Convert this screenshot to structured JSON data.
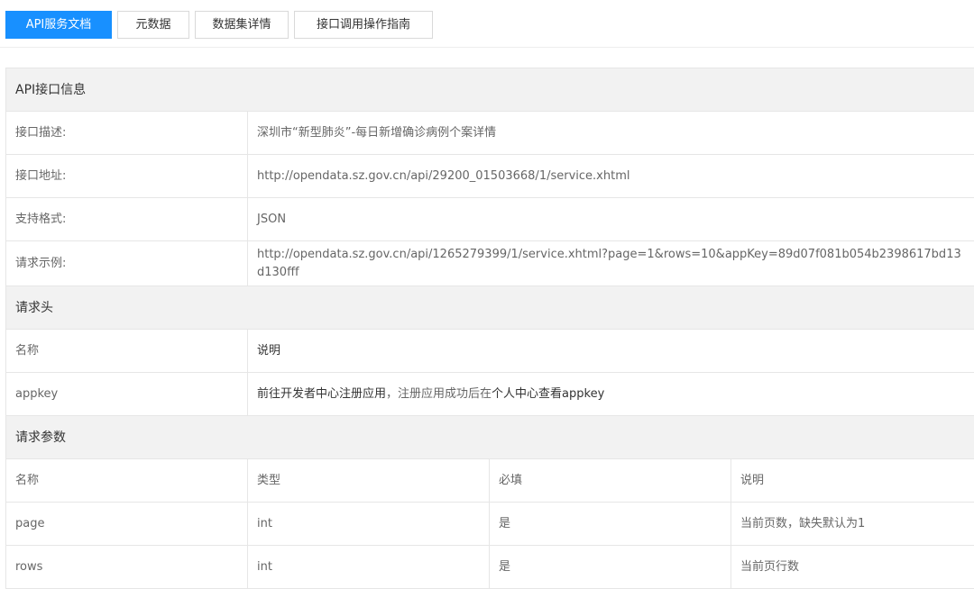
{
  "tabs": [
    {
      "label": "API服务文档",
      "active": true
    },
    {
      "label": "元数据",
      "active": false
    },
    {
      "label": "数据集详情",
      "active": false
    },
    {
      "label": "接口调用操作指南",
      "active": false
    }
  ],
  "api_info": {
    "section_title": "API接口信息",
    "rows": [
      {
        "label": "接口描述:",
        "value": "深圳市“新型肺炎”-每日新增确诊病例个案详情"
      },
      {
        "label": "接口地址:",
        "value": "http://opendata.sz.gov.cn/api/29200_01503668/1/service.xhtml"
      },
      {
        "label": "支持格式:",
        "value": "JSON"
      },
      {
        "label": "请求示例:",
        "value": "http://opendata.sz.gov.cn/api/1265279399/1/service.xhtml?page=1&rows=10&appKey=89d07f081b054b2398617bd13d130fff"
      }
    ]
  },
  "request_header": {
    "section_title": "请求头",
    "columns": [
      "名称",
      "说明"
    ],
    "rows": [
      {
        "name": "appkey",
        "desc_part1": "前往开发者中心注册应用",
        "desc_part2": "，注册应用成功后在",
        "desc_part3": "个人中心查看appkey"
      }
    ]
  },
  "request_params": {
    "section_title": "请求参数",
    "columns": [
      "名称",
      "类型",
      "必填",
      "说明"
    ],
    "rows": [
      {
        "name": "page",
        "type": "int",
        "required": "是",
        "desc": "当前页数，缺失默认为1"
      },
      {
        "name": "rows",
        "type": "int",
        "required": "是",
        "desc": "当前页行数"
      }
    ]
  }
}
